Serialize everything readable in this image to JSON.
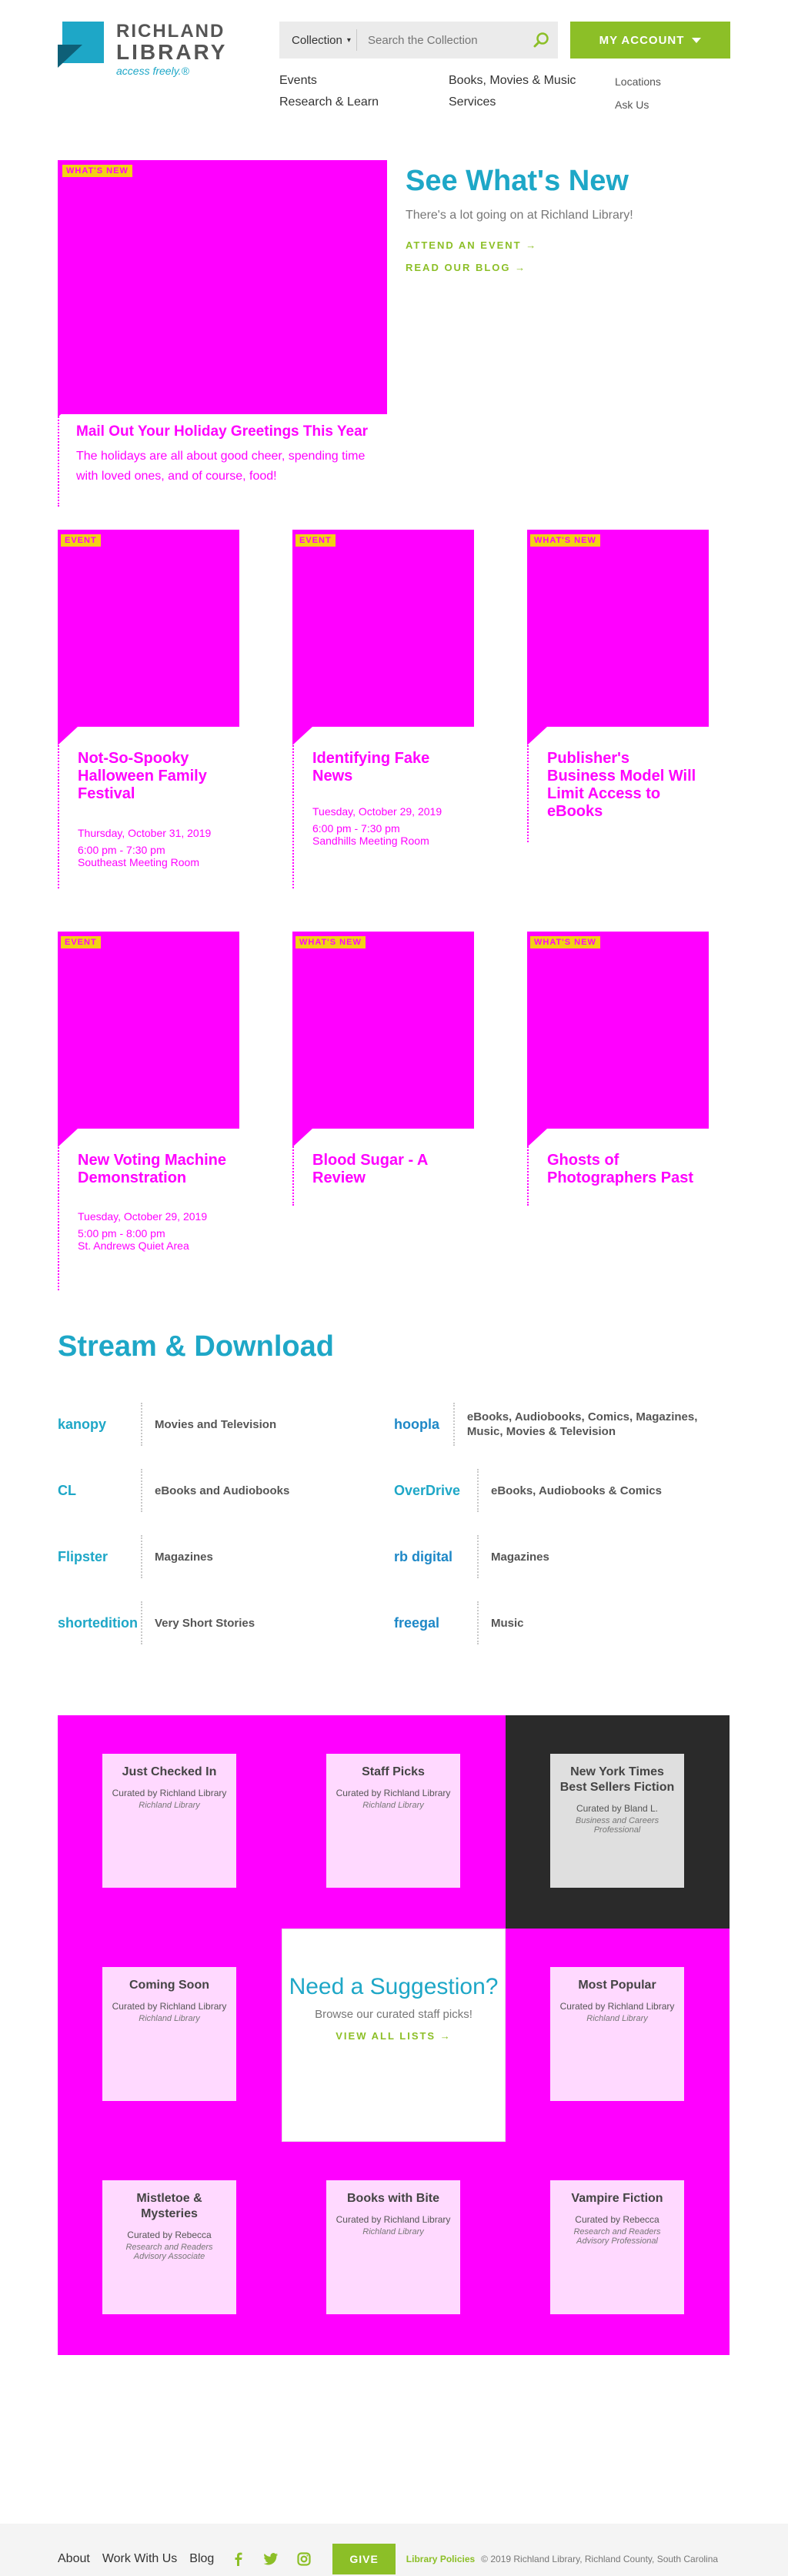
{
  "header": {
    "logo_line1": "RICHLAND",
    "logo_line2": "LIBRARY",
    "logo_tagline": "access freely.®",
    "search_scope": "Collection",
    "search_placeholder": "Search the Collection",
    "account_label": "MY ACCOUNT",
    "nav": {
      "events": "Events",
      "books": "Books, Movies & Music",
      "locations": "Locations",
      "research": "Research & Learn",
      "services": "Services",
      "ask": "Ask Us"
    }
  },
  "featured": {
    "tag": "WHAT'S NEW",
    "title": "Mail Out Your Holiday Greetings This Year",
    "text": "The holidays are all about good cheer, spending time with loved ones, and of course, food!",
    "heading": "See What's New",
    "subtext": "There's a lot going on at Richland Library!",
    "link1": "ATTEND AN EVENT →",
    "link2": "READ OUR BLOG →"
  },
  "cards": [
    {
      "tag": "EVENT",
      "title": "Not-So-Spooky Halloween Family Festival",
      "date": "Thursday, October 31, 2019",
      "time": "6:00 pm - 7:30 pm",
      "place": "Southeast Meeting Room"
    },
    {
      "tag": "EVENT",
      "title": "Identifying Fake News",
      "date": "Tuesday, October 29, 2019",
      "time": "6:00 pm - 7:30 pm",
      "place": "Sandhills Meeting Room"
    },
    {
      "tag": "WHAT'S NEW",
      "title": "Publisher's Business Model Will Limit Access to eBooks",
      "date": "",
      "time": "",
      "place": ""
    },
    {
      "tag": "EVENT",
      "title": "New Voting Machine Demonstration",
      "date": "Tuesday, October 29, 2019",
      "time": "5:00 pm - 8:00 pm",
      "place": "St. Andrews Quiet Area"
    },
    {
      "tag": "WHAT'S NEW",
      "title": "Blood Sugar - A Review",
      "date": "",
      "time": "",
      "place": ""
    },
    {
      "tag": "WHAT'S NEW",
      "title": "Ghosts of Photographers Past",
      "date": "",
      "time": "",
      "place": ""
    }
  ],
  "stream": {
    "heading": "Stream & Download",
    "services": [
      {
        "logo": "kanopy",
        "label": "Movies and Television",
        "color": "#1ea7c7"
      },
      {
        "logo": "hoopla",
        "label": "eBooks, Audiobooks, Comics, Magazines, Music, Movies & Television",
        "color": "#1e88c7"
      },
      {
        "logo": "CL",
        "label": "eBooks and Audiobooks",
        "color": "#1ea7c7"
      },
      {
        "logo": "OverDrive",
        "label": "eBooks, Audiobooks & Comics",
        "color": "#1ea7c7"
      },
      {
        "logo": "Flipster",
        "label": "Magazines",
        "color": "#1ea7c7"
      },
      {
        "logo": "rb digital",
        "label": "Magazines",
        "color": "#1e88c7"
      },
      {
        "logo": "shortedition",
        "label": "Very Short Stories",
        "color": "#1ea7c7"
      },
      {
        "logo": "freegal",
        "label": "Music",
        "color": "#1e88c7"
      }
    ]
  },
  "lists": {
    "tiles": [
      {
        "title": "Just Checked In",
        "by": "Curated by Richland Library",
        "role": "Richland Library"
      },
      {
        "title": "Staff Picks",
        "by": "Curated by Richland Library",
        "role": "Richland Library"
      },
      {
        "title": "New York Times Best Sellers Fiction",
        "by": "Curated by Bland L.",
        "role": "Business and Careers Professional"
      },
      {
        "title": "Coming Soon",
        "by": "Curated by Richland Library",
        "role": "Richland Library"
      },
      {
        "title": "Most Popular",
        "by": "Curated by Richland Library",
        "role": "Richland Library"
      },
      {
        "title": "Mistletoe & Mysteries",
        "by": "Curated by Rebecca",
        "role": "Research and Readers Advisory Associate"
      },
      {
        "title": "Books with Bite",
        "by": "Curated by Richland Library",
        "role": "Richland Library"
      },
      {
        "title": "Vampire Fiction",
        "by": "Curated by Rebecca",
        "role": "Research and Readers Advisory Professional"
      }
    ],
    "suggest_heading": "Need a Suggestion?",
    "suggest_text": "Browse our curated staff picks!",
    "suggest_link": "VIEW ALL LISTS →"
  },
  "footer": {
    "about": "About",
    "work": "Work With Us",
    "blog": "Blog",
    "give": "GIVE",
    "policies": "Library Policies",
    "copyright": "© 2019 Richland Library, Richland County, South Carolina"
  },
  "colors": {
    "brand": "#1ea7c7",
    "accent": "#8cbf27",
    "placeholder_image": "#ff00ff"
  }
}
